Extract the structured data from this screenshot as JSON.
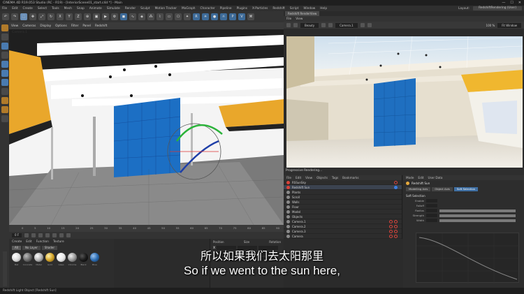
{
  "window": {
    "title": "CINEMA 4D R19.053 Studio (RC - R19) - [InteriorScene01_start.c4d *] - Main",
    "controls": [
      "—",
      "☐",
      "✕"
    ]
  },
  "menubar": {
    "items": [
      "File",
      "Edit",
      "Create",
      "Select",
      "Tools",
      "Mesh",
      "Snap",
      "Animate",
      "Simulate",
      "Render",
      "Sculpt",
      "Motion Tracker",
      "MoGraph",
      "Character",
      "Pipeline",
      "Plugins",
      "X-Particles",
      "Redshift",
      "Script",
      "Window",
      "Help"
    ],
    "layout_label": "Layout:",
    "layout_value": "RedshiftRendering (User)"
  },
  "viewport": {
    "menu": [
      "View",
      "Cameras",
      "Display",
      "Options",
      "Filter",
      "Panel",
      "Redshift"
    ],
    "label": "Camera.1"
  },
  "timeline": {
    "ticks": [
      "0",
      "5",
      "10",
      "15",
      "20",
      "25",
      "30",
      "35",
      "40",
      "45",
      "50",
      "55",
      "60",
      "65",
      "70",
      "75",
      "80",
      "85",
      "90"
    ],
    "frame": "0 F"
  },
  "materials": {
    "menu": [
      "Create",
      "Edit",
      "Function",
      "Texture"
    ],
    "tabs": [
      "All",
      "No Layer",
      "Shader"
    ],
    "items": [
      {
        "name": "Mat",
        "color": "#dcdcdc"
      },
      {
        "name": "Concrete",
        "color": "#6d6d6d"
      },
      {
        "name": "Metal",
        "color": "#b5b5b5"
      },
      {
        "name": "Gold",
        "color": "#d4a52a"
      },
      {
        "name": "Glass",
        "color": "#e8e8e8"
      },
      {
        "name": "Chrome",
        "color": "#9a9a9a"
      },
      {
        "name": "Black",
        "color": "#1c1c1c"
      },
      {
        "name": "Blue",
        "color": "#2e6fb5"
      }
    ]
  },
  "coordinates": {
    "headers": [
      "Position",
      "Size",
      "Rotation"
    ],
    "axes": [
      "X",
      "Y",
      "Z"
    ]
  },
  "render_view": {
    "tab": "Redshift RenderView",
    "menu": [
      "File",
      "View"
    ],
    "beauty": "Beauty",
    "camera": "Camera.1",
    "zoom": "100 %",
    "aov": "Fit Window",
    "progress": "Progressive Rendering..."
  },
  "objects": {
    "menu": [
      "File",
      "Edit",
      "View",
      "Objects",
      "Tags",
      "Bookmarks"
    ],
    "rows": [
      {
        "name": "RSSunSky",
        "red": true
      },
      {
        "name": "Redshift Sun",
        "red": true,
        "selected": true
      },
      {
        "name": "Plants",
        "red": false
      },
      {
        "name": "Scroll",
        "red": false
      },
      {
        "name": "Walls",
        "red": false
      },
      {
        "name": "Floor",
        "red": false
      },
      {
        "name": "Model",
        "red": false
      },
      {
        "name": "Objects",
        "red": false
      },
      {
        "name": "Camera.1",
        "red": false,
        "tags": 2
      },
      {
        "name": "Camera.2",
        "red": false,
        "tags": 2
      },
      {
        "name": "Camera.3",
        "red": false,
        "tags": 2
      },
      {
        "name": "Camera",
        "red": false,
        "tags": 2
      }
    ]
  },
  "attributes": {
    "menu": [
      "Mode",
      "Edit",
      "User Data"
    ],
    "title": "Redshift Sun",
    "tabs": [
      "Basic",
      "Coord.",
      "Object",
      "Shadow",
      "Details",
      "Soft Selection"
    ],
    "tabs_visible": [
      "Modelling Axis",
      "Object Axis",
      "Soft Selection"
    ],
    "section": "Soft Selection",
    "props": [
      "Enable",
      "Falloff",
      "Radius",
      "Strength",
      "Width"
    ]
  },
  "status": "Redshift Light Object [Redshift Sun]",
  "subtitles": {
    "cn": "所以如果我们去太阳那里",
    "en": "So if we went to the sun here,"
  }
}
